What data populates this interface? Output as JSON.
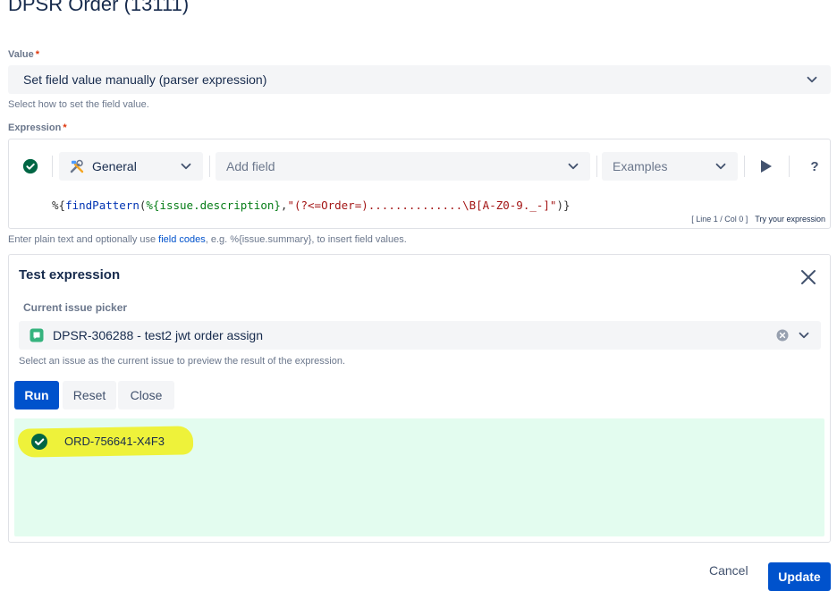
{
  "page": {
    "title": "DPSR Order (13111)"
  },
  "value_field": {
    "label": "Value",
    "required_mark": "*",
    "selected": "Set field value manually (parser expression)",
    "help": "Select how to set the field value."
  },
  "expression_field": {
    "label": "Expression",
    "required_mark": "*",
    "toolbar": {
      "status_icon": "check-circle-icon",
      "category_select": "General",
      "add_field_placeholder": "Add field",
      "examples_placeholder": "Examples",
      "run_icon": "play-icon",
      "help_label": "?"
    },
    "code": {
      "prefix": "%{",
      "fn": "findPattern",
      "open": "(",
      "var": "%{issue.description}",
      "comma": ",",
      "str": "\"(?<=Order=)..............\\B[A-Z0-9._-]\"",
      "close": ")}"
    },
    "cursor_info": "[ Line 1 / Col 0 ]",
    "try_label": "Try your expression",
    "help_before": "Enter plain text and optionally use ",
    "help_link": "field codes",
    "help_after": ", e.g. %{issue.summary}, to insert field values."
  },
  "test_panel": {
    "title": "Test expression",
    "picker_label": "Current issue picker",
    "picker_value": "DPSR-306288 - test2 jwt order assign",
    "picker_help": "Select an issue as the current issue to preview the result of the expression.",
    "buttons": {
      "run": "Run",
      "reset": "Reset",
      "close": "Close"
    },
    "result": {
      "text": "ORD-756641-X4F3",
      "highlight_color": "#eef23a"
    }
  },
  "footer": {
    "cancel": "Cancel",
    "update": "Update"
  },
  "colors": {
    "primary": "#0052cc",
    "success": "#006644",
    "result_bg": "#e3fcef",
    "story_green": "#36b37e"
  }
}
